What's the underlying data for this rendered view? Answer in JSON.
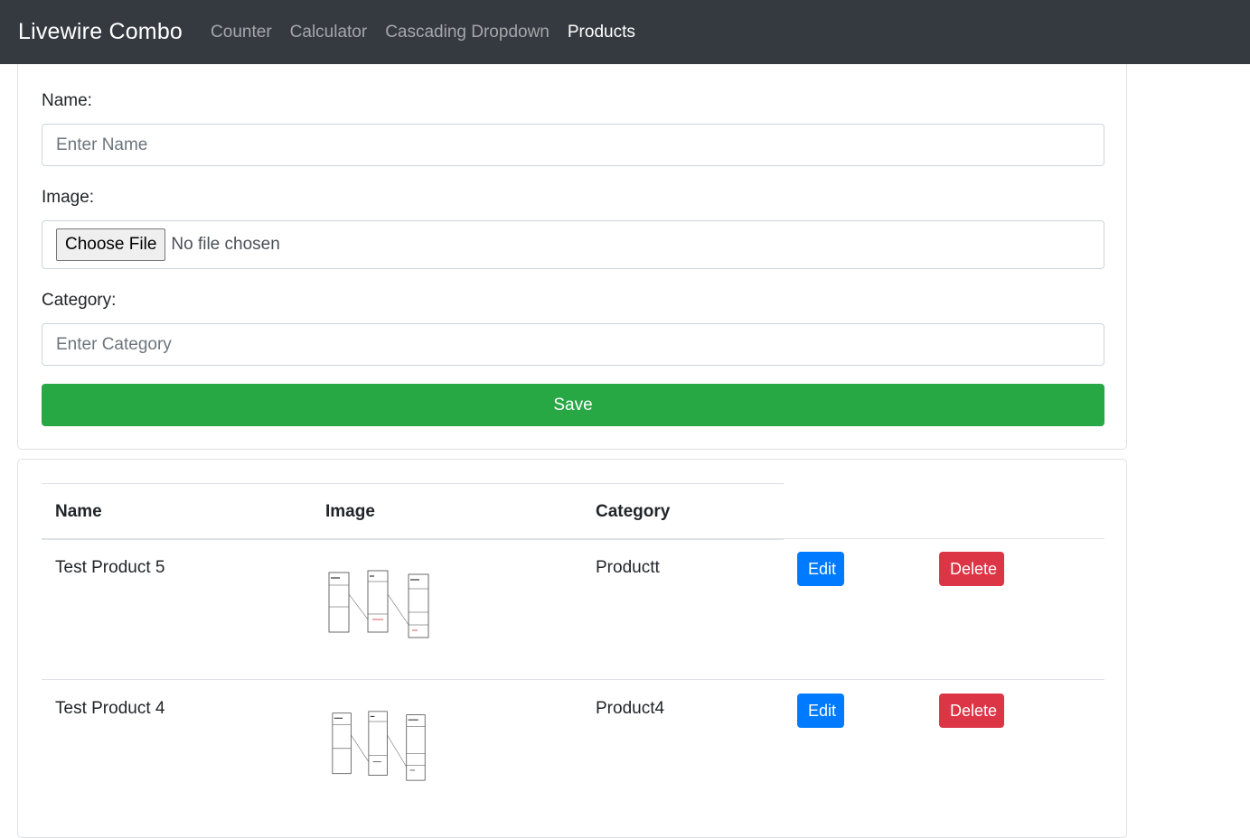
{
  "navbar": {
    "brand": "Livewire Combo",
    "links": [
      "Counter",
      "Calculator",
      "Cascading Dropdown",
      "Products"
    ],
    "active": "Products"
  },
  "form": {
    "name_label": "Name:",
    "name_placeholder": "Enter Name",
    "image_label": "Image:",
    "file_button": "Choose File",
    "file_status": "No file chosen",
    "category_label": "Category:",
    "category_placeholder": "Enter Category",
    "save_label": "Save"
  },
  "table": {
    "headers": [
      "Name",
      "Image",
      "Category"
    ],
    "rows": [
      {
        "name": "Test Product 5",
        "image_icon": "diagram-thumbnail",
        "category": "Productt",
        "edit": "Edit",
        "delete": "Delete"
      },
      {
        "name": "Test Product 4",
        "image_icon": "diagram-thumbnail",
        "category": "Product4",
        "edit": "Edit",
        "delete": "Delete"
      }
    ]
  },
  "colors": {
    "navbar_bg": "#343a40",
    "save": "#28a745",
    "edit": "#007bff",
    "delete": "#dc3545"
  }
}
